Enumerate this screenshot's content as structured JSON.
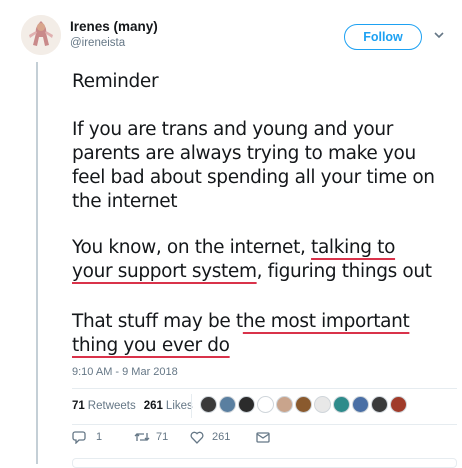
{
  "author": {
    "display_name": "Irenes (many)",
    "handle": "@ireneista"
  },
  "follow_label": "Follow",
  "tweet": {
    "p1": "Reminder",
    "p2_lines": [
      "If you are trans and young and your",
      "parents are always trying to make you",
      "feel bad about spending all your time on",
      "the internet"
    ],
    "p3_line1_a": "You know, on the internet, ",
    "p3_line1_b": "talking to",
    "p3_line2_a": "your support system",
    "p3_line2_b": ", figuring things out",
    "p4_line1_a": "That stuff may be t",
    "p4_line1_b": "he most important",
    "p4_line2": "thing you ever do"
  },
  "timestamp": "9:10 AM - 9 Mar 2018",
  "stats": {
    "retweets_count": "71",
    "retweets_label": "Retweets",
    "likes_count": "261",
    "likes_label": "Likes"
  },
  "liker_avatar_colors": [
    "#3a3a3a",
    "#5a7fa0",
    "#2b2b2b",
    "#ffffff",
    "#c9a48c",
    "#8a5a2e",
    "#e8e8e8",
    "#2e8b8b",
    "#4a6fa5",
    "#3b3b3b",
    "#a03b2a"
  ],
  "actions": {
    "replies": "1",
    "retweets": "71",
    "likes": "261"
  },
  "icons": [
    "caret-down-icon",
    "reply-icon",
    "retweet-icon",
    "heart-icon",
    "mail-icon"
  ]
}
